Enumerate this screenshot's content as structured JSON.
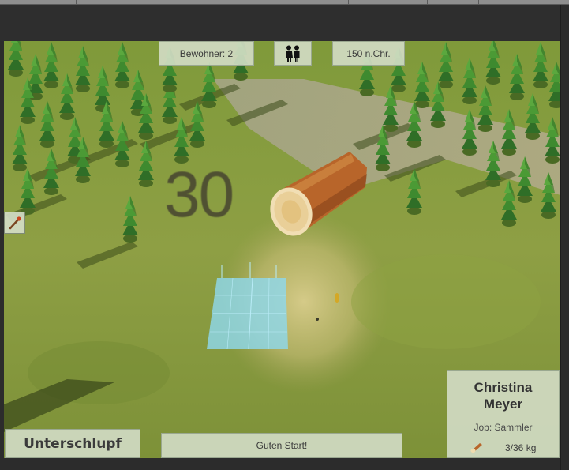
{
  "hud": {
    "residents_label": "Bewohner: 2",
    "year_label": "150 n.Chr.",
    "people_icon": "people-icon",
    "tool_icon": "torch-icon"
  },
  "timer": {
    "value": "30"
  },
  "building": {
    "label": "Unterschlupf"
  },
  "message": {
    "text": "Guten Start!"
  },
  "character": {
    "first_name": "Christina",
    "last_name": "Meyer",
    "job_label": "Job: Sammler",
    "carry": "3/36 kg",
    "carry_icon": "log-icon"
  },
  "colors": {
    "panel_bg": "#d5dec9",
    "grass": "#8a9a3c",
    "placement_tile": "#8fd8ec",
    "wood": "#b8652a"
  }
}
